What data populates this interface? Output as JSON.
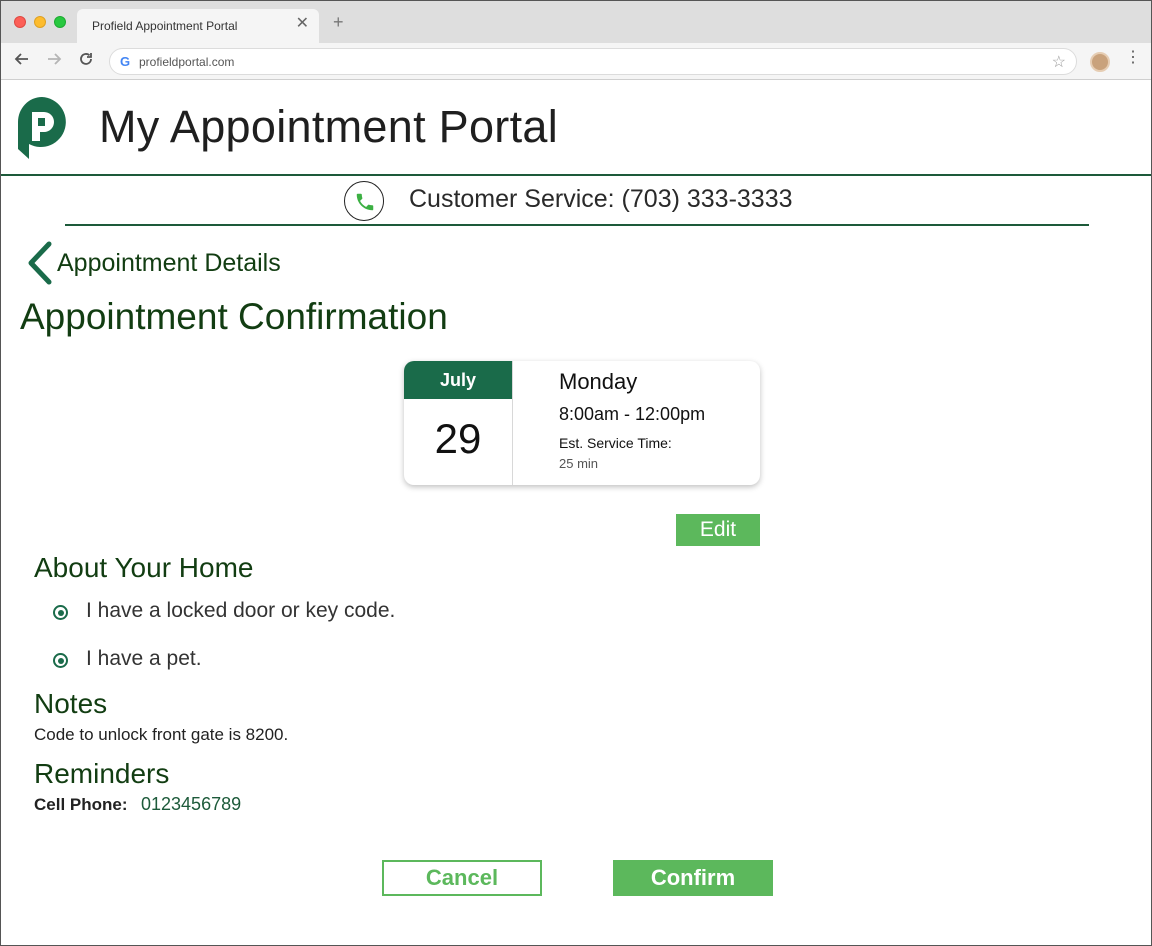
{
  "browser": {
    "tab_title": "Profield Appointment Portal",
    "tab_close": "✕",
    "new_tab": "+",
    "url": "profieldportal.com",
    "icons": [
      "back-arrow-icon",
      "forward-arrow-icon",
      "reload-icon",
      "google-icon",
      "star-icon",
      "profile-icon",
      "menu-icon"
    ]
  },
  "header": {
    "title": "My Appointment Portal",
    "logo_icon": "profield-logo-icon",
    "brand_color": "#1a6b4a"
  },
  "customer_service": {
    "label": "Customer Service: (703) 333-3333",
    "icon": "phone-icon"
  },
  "back_link": {
    "label": "Appointment Details",
    "icon": "chevron-left-icon"
  },
  "page_title": "Appointment Confirmation",
  "appointment": {
    "month": "July",
    "day": "29",
    "weekday": "Monday",
    "time_range": "8:00am - 12:00pm",
    "est_label": "Est. Service Time:",
    "est_value": "25 min"
  },
  "edit_label": "Edit",
  "about_home": {
    "heading": "About Your Home",
    "options": [
      {
        "label": "I have a locked door or key code.",
        "selected": true
      },
      {
        "label": "I have a pet.",
        "selected": true
      }
    ]
  },
  "notes": {
    "heading": "Notes",
    "text": "Code to unlock front gate is 8200."
  },
  "reminders": {
    "heading": "Reminders",
    "cell_label": "Cell Phone:",
    "cell_value": "0123456789"
  },
  "actions": {
    "cancel_label": "Cancel",
    "confirm_label": "Confirm"
  },
  "colors": {
    "accent_green": "#5cb85c",
    "dark_green": "#1a6b4a",
    "heading_green": "#123d12"
  }
}
